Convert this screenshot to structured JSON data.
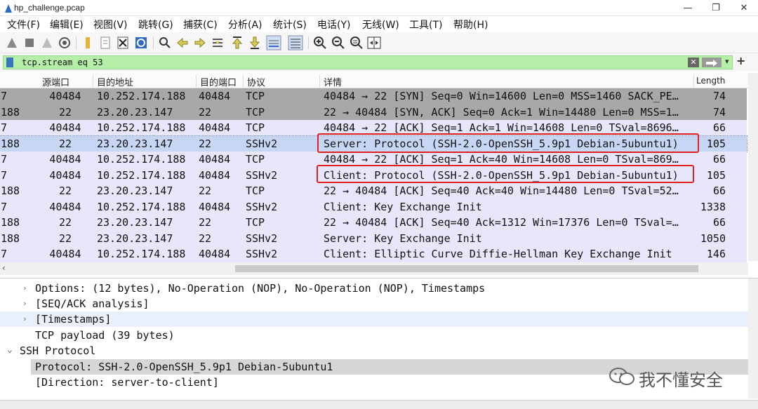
{
  "window": {
    "title": "hp_challenge.pcap"
  },
  "menu": [
    "文件(F)",
    "编辑(E)",
    "视图(V)",
    "跳转(G)",
    "捕获(C)",
    "分析(A)",
    "统计(S)",
    "电话(Y)",
    "无线(W)",
    "工具(T)",
    "帮助(H)"
  ],
  "filter": {
    "value": "tcp.stream eq 53"
  },
  "columns": {
    "src_port": "源端口",
    "dst_addr": "目的地址",
    "dst_port": "目的端口",
    "protocol": "协议",
    "info": "详情",
    "length": "Length"
  },
  "packets": [
    {
      "no": "7",
      "src_port": "40484",
      "dst": "10.252.174.188",
      "dst_port": "40484",
      "proto": "TCP",
      "info": "40484 → 22 [SYN] Seq=0 Win=14600 Len=0 MSS=1460 SACK_PE…",
      "length": "74",
      "style": "gray"
    },
    {
      "no": "188",
      "src_port": "22",
      "dst": "23.20.23.147",
      "dst_port": "22",
      "proto": "TCP",
      "info": "22 → 40484 [SYN, ACK] Seq=0 Ack=1 Win=14480 Len=0 MSS=1…",
      "length": "74",
      "style": "gray"
    },
    {
      "no": "7",
      "src_port": "40484",
      "dst": "10.252.174.188",
      "dst_port": "40484",
      "proto": "TCP",
      "info": "40484 → 22 [ACK] Seq=1 Ack=1 Win=14608 Len=0 TSval=8696…",
      "length": "66",
      "style": "lav"
    },
    {
      "no": "188",
      "src_port": "22",
      "dst": "23.20.23.147",
      "dst_port": "22",
      "proto": "SSHv2",
      "info": "Server: Protocol (SSH-2.0-OpenSSH_5.9p1 Debian-5ubuntu1)",
      "length": "105",
      "style": "sel"
    },
    {
      "no": "7",
      "src_port": "40484",
      "dst": "10.252.174.188",
      "dst_port": "40484",
      "proto": "TCP",
      "info": "40484 → 22 [ACK] Seq=1 Ack=40 Win=14608 Len=0 TSval=869…",
      "length": "66",
      "style": "lav"
    },
    {
      "no": "7",
      "src_port": "40484",
      "dst": "10.252.174.188",
      "dst_port": "40484",
      "proto": "SSHv2",
      "info": "Client: Protocol (SSH-2.0-OpenSSH_5.9p1 Debian-5ubuntu1)",
      "length": "105",
      "style": "lav"
    },
    {
      "no": "188",
      "src_port": "22",
      "dst": "23.20.23.147",
      "dst_port": "22",
      "proto": "TCP",
      "info": "22 → 40484 [ACK] Seq=40 Ack=40 Win=14480 Len=0 TSval=52…",
      "length": "66",
      "style": "lav"
    },
    {
      "no": "7",
      "src_port": "40484",
      "dst": "10.252.174.188",
      "dst_port": "40484",
      "proto": "SSHv2",
      "info": "Client: Key Exchange Init",
      "length": "1338",
      "style": "lav"
    },
    {
      "no": "188",
      "src_port": "22",
      "dst": "23.20.23.147",
      "dst_port": "22",
      "proto": "TCP",
      "info": "22 → 40484 [ACK] Seq=40 Ack=1312 Win=17376 Len=0 TSval=…",
      "length": "66",
      "style": "lav"
    },
    {
      "no": "188",
      "src_port": "22",
      "dst": "23.20.23.147",
      "dst_port": "22",
      "proto": "SSHv2",
      "info": "Server: Key Exchange Init",
      "length": "1050",
      "style": "lav"
    },
    {
      "no": "7",
      "src_port": "40484",
      "dst": "10.252.174.188",
      "dst_port": "40484",
      "proto": "SSHv2",
      "info": "Client: Elliptic Curve Diffie-Hellman Key Exchange Init",
      "length": "146",
      "style": "lav"
    }
  ],
  "details": [
    {
      "text": "Options: (12 bytes), No-Operation (NOP), No-Operation (NOP), Timestamps",
      "arrow": "›"
    },
    {
      "text": "[SEQ/ACK analysis]",
      "arrow": "›"
    },
    {
      "text": "[Timestamps]",
      "arrow": "›"
    },
    {
      "text": "TCP payload (39 bytes)",
      "arrow": ""
    },
    {
      "text": "SSH Protocol",
      "arrow": "⌄"
    },
    {
      "text": "Protocol: SSH-2.0-OpenSSH_5.9p1 Debian-5ubuntu1",
      "arrow": ""
    },
    {
      "text": "[Direction: server-to-client]",
      "arrow": ""
    }
  ],
  "watermark": {
    "text": "我不懂安全"
  },
  "colors": {
    "filter_ok": "#b6f0a8",
    "selected_row": "#c6d6f4",
    "tcp_gray": "#a8a8a8",
    "lavender": "#e8e6fb",
    "highlight_box": "#e02020"
  }
}
